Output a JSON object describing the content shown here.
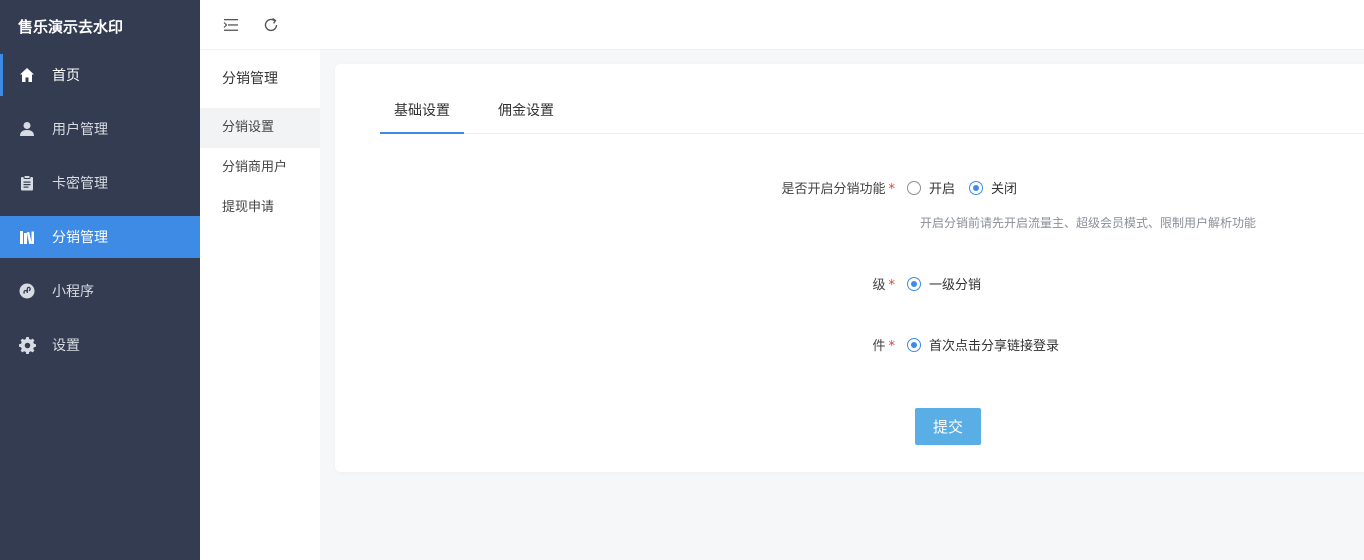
{
  "brand": {
    "title": "售乐演示去水印"
  },
  "sidebar": {
    "items": [
      {
        "label": "首页",
        "icon": "home-icon"
      },
      {
        "label": "用户管理",
        "icon": "user-icon"
      },
      {
        "label": "卡密管理",
        "icon": "clipboard-icon"
      },
      {
        "label": "分销管理",
        "icon": "books-icon"
      },
      {
        "label": "小程序",
        "icon": "mini-program-icon"
      },
      {
        "label": "设置",
        "icon": "gear-icon"
      }
    ],
    "active_index": 3
  },
  "topbar": {
    "menu_icon": "menu-fold-icon",
    "refresh_icon": "refresh-icon"
  },
  "subnav": {
    "title": "分销管理",
    "items": [
      "分销设置",
      "分销商用户",
      "提现申请"
    ],
    "active_index": 0
  },
  "tabs": [
    "基础设置",
    "佣金设置"
  ],
  "form": {
    "enable": {
      "label": "是否开启分销功能",
      "required_mark": "*",
      "options": [
        "开启",
        "关闭"
      ],
      "selected": "关闭",
      "hint": "开启分销前请先开启流量主、超级会员模式、限制用户解析功能"
    },
    "level": {
      "label": "级",
      "required_mark": "*",
      "options": [
        "一级分销"
      ],
      "selected": "一级分销"
    },
    "condition": {
      "label": "件",
      "required_mark": "*",
      "options": [
        "首次点击分享链接登录"
      ],
      "selected": "首次点击分享链接登录"
    },
    "submit_label": "提交"
  },
  "colors": {
    "sidebar_bg": "#333c51",
    "accent": "#3e8be6",
    "submit_bg": "#5aaee6",
    "required": "#e23a3a"
  }
}
